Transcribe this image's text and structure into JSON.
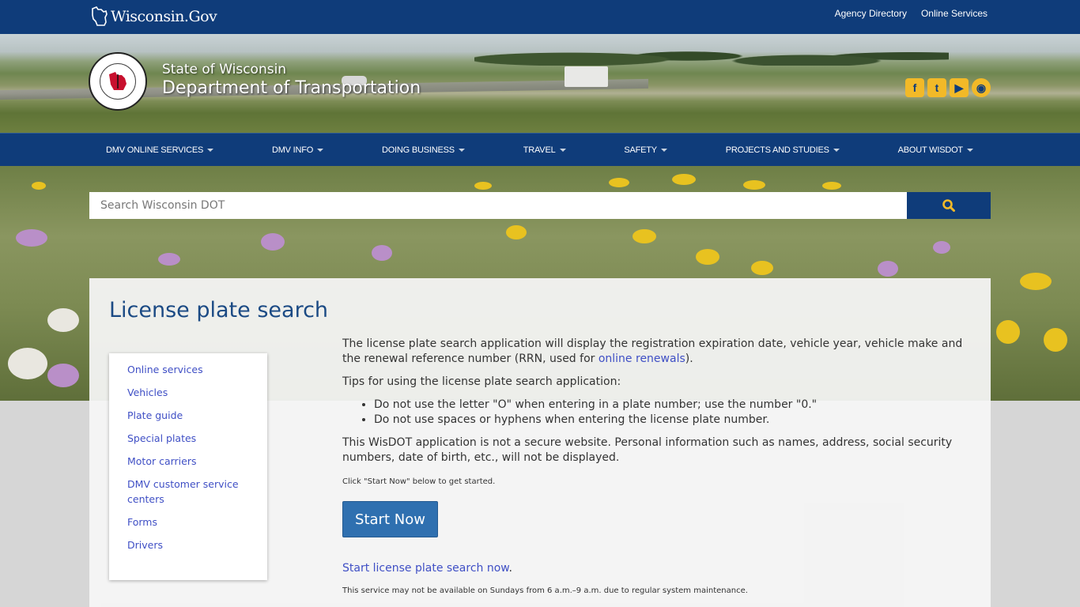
{
  "topbar": {
    "logo_text": "Wisconsin.Gov",
    "links": [
      "Agency Directory",
      "Online Services"
    ]
  },
  "header": {
    "state": "State of Wisconsin",
    "department": "Department of Transportation",
    "social": [
      {
        "icon": "facebook-icon",
        "glyph": "f"
      },
      {
        "icon": "twitter-icon",
        "glyph": "t"
      },
      {
        "icon": "youtube-icon",
        "glyph": "▶"
      },
      {
        "icon": "podcast-icon",
        "glyph": "◉"
      }
    ]
  },
  "nav": {
    "items": [
      "DMV ONLINE SERVICES",
      "DMV INFO",
      "DOING BUSINESS",
      "TRAVEL",
      "SAFETY",
      "PROJECTS AND STUDIES",
      "ABOUT WISDOT"
    ]
  },
  "search": {
    "placeholder": "Search Wisconsin DOT"
  },
  "page": {
    "title": "License plate search",
    "sidebar": [
      "Online services",
      "Vehicles",
      "Plate guide",
      "Special plates",
      "Motor carriers",
      "DMV customer service centers",
      "Forms",
      "Drivers"
    ],
    "intro_before": "The license plate search application will display the registration expiration date, vehicle year, vehicle make and the renewal reference number (RRN, used for ",
    "intro_link": "online renewals",
    "intro_after": ").",
    "tips_heading": "Tips for using the license plate search application:",
    "tips": [
      "Do not use the letter \"O\" when entering in a plate number; use the number \"0.\"",
      "Do not use spaces or hyphens when entering the license plate number."
    ],
    "security_note": "This WisDOT application is not a secure website. Personal information such as names, address, social security numbers, date of birth, etc., will not be displayed.",
    "start_hint": "Click \"Start Now\" below to get started.",
    "start_button": "Start Now",
    "start_link": "Start license plate search now",
    "start_link_suffix": ".",
    "maintenance": "This service may not be available on Sundays from 6 a.m.–9 a.m. due to regular system maintenance."
  },
  "colors": {
    "brand_blue": "#0f3c7a",
    "accent_gold": "#f2b928",
    "link": "#3f4fc5",
    "button": "#2f70b0"
  }
}
